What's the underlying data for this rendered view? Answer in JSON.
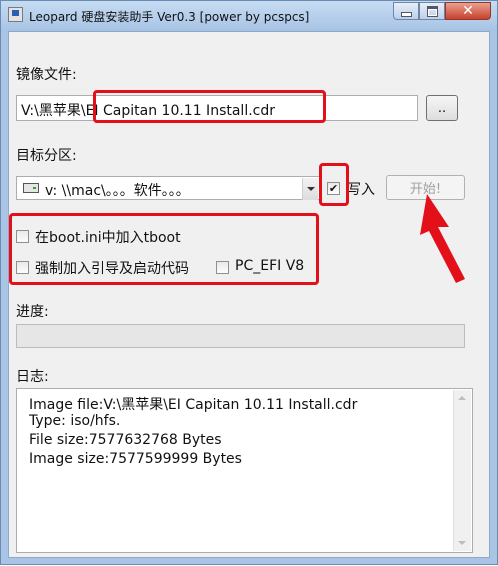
{
  "window": {
    "title": "Leopard 硬盘安装助手 Ver0.3 [power by pcspcs]"
  },
  "image_file": {
    "label": "镜像文件:",
    "value": "V:\\黑苹果\\EI Capitan 10.11 Install.cdr",
    "browse_label": ".."
  },
  "target_partition": {
    "label": "目标分区:",
    "selected": "v: \\\\mac\\。。。软件。。。",
    "write_label": "写入",
    "write_checked": true,
    "start_label": "开始!"
  },
  "options": {
    "boot_ini_label": "在boot.ini中加入tboot",
    "boot_ini_checked": false,
    "force_boot_label": "强制加入引导及启动代码",
    "force_boot_checked": false,
    "pc_efi_label": "PC_EFI V8",
    "pc_efi_checked": false
  },
  "progress": {
    "label": "进度:",
    "value": 0
  },
  "log": {
    "label": "日志:",
    "lines": [
      "Image file:V:\\黑苹果\\EI Capitan 10.11 Install.cdr",
      "Type: iso/hfs.",
      "File size:7577632768 Bytes",
      "Image size:7577599999 Bytes"
    ]
  },
  "colors": {
    "highlight": "#e3101a",
    "title_bar": "#a9c4e4"
  }
}
